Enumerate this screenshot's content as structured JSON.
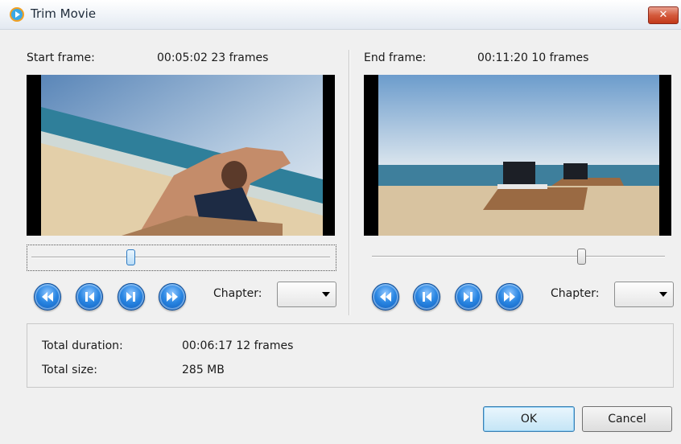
{
  "window": {
    "title": "Trim Movie",
    "close_glyph": "✕"
  },
  "start": {
    "label": "Start frame:",
    "time": "00:05:02 23 frames",
    "position": 0.33,
    "chapter_label": "Chapter:",
    "chapter_value": ""
  },
  "end": {
    "label": "End frame:",
    "time": "00:11:20 10 frames",
    "position": 0.72,
    "chapter_label": "Chapter:",
    "chapter_value": ""
  },
  "summary": {
    "duration_label": "Total duration:",
    "duration_value": "00:06:17 12 frames",
    "size_label": "Total size:",
    "size_value": "285 MB"
  },
  "buttons": {
    "ok": "OK",
    "cancel": "Cancel"
  },
  "icons": {
    "app": "wmp-icon",
    "nav": [
      "previous-chapter-icon",
      "previous-frame-icon",
      "next-frame-icon",
      "next-chapter-icon"
    ]
  },
  "colors": {
    "accent": "#2a86e2",
    "close": "#c2391a"
  }
}
